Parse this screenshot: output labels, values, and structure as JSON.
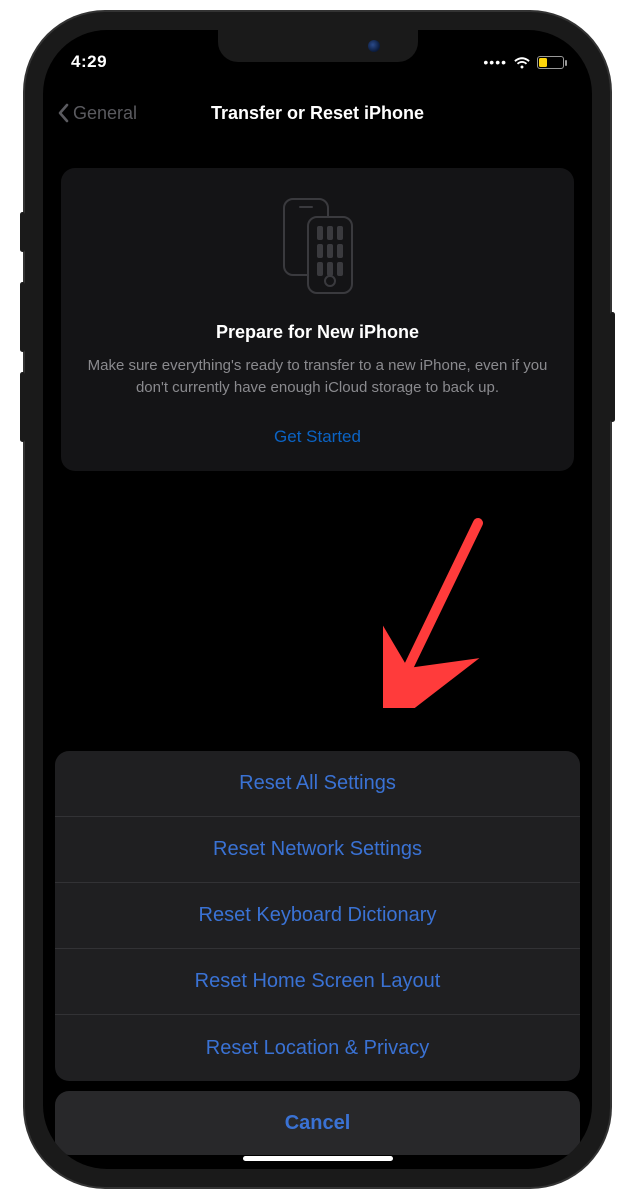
{
  "status": {
    "time": "4:29"
  },
  "nav": {
    "back": "General",
    "title": "Transfer or Reset iPhone"
  },
  "prepare_card": {
    "title": "Prepare for New iPhone",
    "description": "Make sure everything's ready to transfer to a new iPhone, even if you don't currently have enough iCloud storage to back up.",
    "cta": "Get Started"
  },
  "action_sheet": {
    "items": [
      "Reset All Settings",
      "Reset Network Settings",
      "Reset Keyboard Dictionary",
      "Reset Home Screen Layout",
      "Reset Location & Privacy"
    ],
    "cancel": "Cancel"
  },
  "annotation": {
    "points_to": "reset-all-settings"
  },
  "colors": {
    "link": "#3a72d4",
    "muted": "#8a8a8e",
    "battery_fill": "#ffd60a"
  }
}
